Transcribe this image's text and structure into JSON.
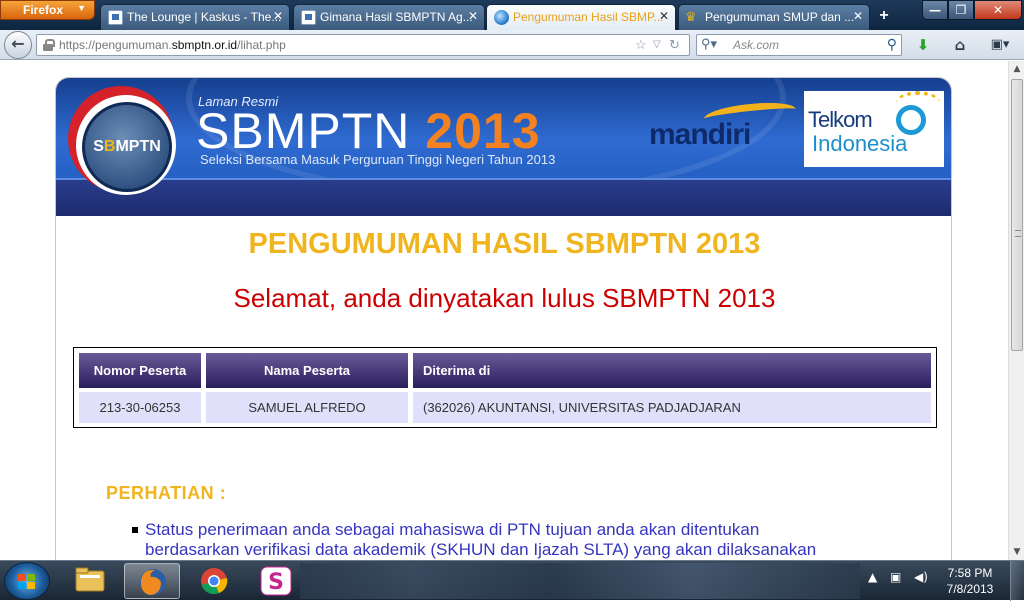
{
  "browser": {
    "app_button": "Firefox",
    "tabs": [
      {
        "title": "The Lounge | Kaskus - The...",
        "icon": "kaskus-doc-icon",
        "active": false
      },
      {
        "title": "Gimana Hasil SBMPTN Ag...",
        "icon": "kaskus-doc-icon",
        "active": false
      },
      {
        "title": "Pengumuman Hasil SBMP...",
        "icon": "sbmptn-globe-icon",
        "active": true
      },
      {
        "title": "Pengumuman SMUP dan ...",
        "icon": "crown-icon",
        "active": false
      }
    ],
    "new_tab_label": "+",
    "url_prefix": "https://pengumuman.",
    "url_domain": "sbmptn.or.id",
    "url_path": "/lihat.php",
    "search_placeholder": "Ask.com"
  },
  "page": {
    "banner": {
      "logo_text_1": "S",
      "logo_text_2": "B",
      "logo_text_3": "MPTN",
      "laman_resmi": "Laman Resmi",
      "title": "SBMPTN",
      "year": "2013",
      "subtitle": "Seleksi Bersama Masuk Perguruan Tinggi Negeri Tahun 2013",
      "sponsor_1": "mandiri",
      "sponsor_2_line1": "Telkom",
      "sponsor_2_line2": "Indonesia"
    },
    "heading": "PENGUMUMAN HASIL SBMPTN 2013",
    "result_message": "Selamat, anda dinyatakan lulus SBMPTN 2013",
    "table": {
      "headers": [
        "Nomor Peserta",
        "Nama Peserta",
        "Diterima di"
      ],
      "row": [
        "213-30-06253",
        "SAMUEL ALFREDO",
        "(362026) AKUNTANSI, UNIVERSITAS PADJADJARAN"
      ]
    },
    "perhatian": "PERHATIAN :",
    "notice_line_1": "Status penerimaan anda sebagai mahasiswa di PTN tujuan anda akan ditentukan",
    "notice_line_2": "berdasarkan verifikasi data akademik (SKHUN dan Ijazah SLTA) yang akan dilaksanakan"
  },
  "taskbar": {
    "time": "7:58 PM",
    "date": "7/8/2013"
  },
  "colors": {
    "heading": "#f0b51e",
    "result": "#cc0000",
    "table_header": "#2a1e5c",
    "table_row": "#e0e0fb",
    "notice": "#3535c0"
  }
}
